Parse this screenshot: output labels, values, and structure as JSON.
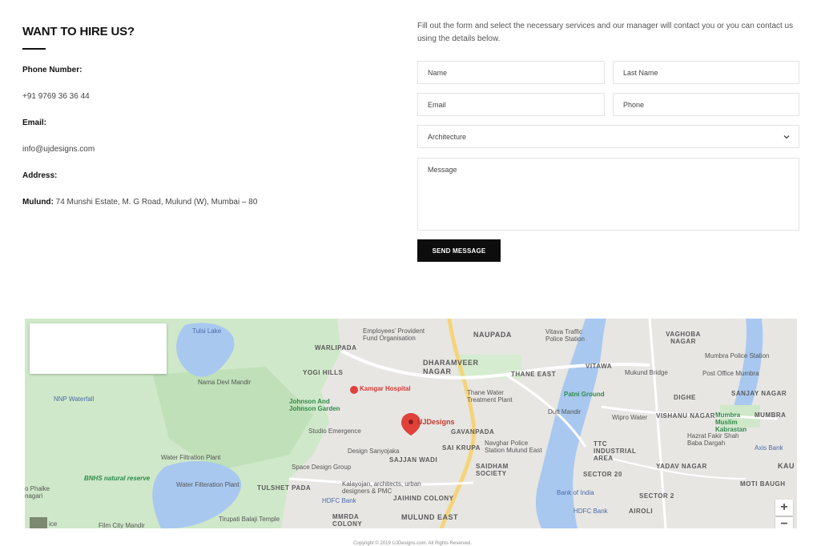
{
  "contact": {
    "title": "WANT TO HIRE US?",
    "phone_label": "Phone Number:",
    "phone_value": "+91 9769 36 36 44",
    "email_label": "Email:",
    "email_value": "info@ujdesigns.com",
    "address_label": "Address:",
    "address_city": "Mulund:",
    "address_value": "74 Munshi Estate, M. G Road, Mulund (W), Mumbai – 80"
  },
  "form": {
    "intro": "Fill out the form and select the necessary services and our manager will contact you or you can contact us using the details below.",
    "name_placeholder": "Name",
    "lastname_placeholder": "Last Name",
    "email_placeholder": "Email",
    "phone_placeholder": "Phone",
    "service_selected": "Architecture",
    "message_placeholder": "Message",
    "send_label": "SEND MESSAGE"
  },
  "map": {
    "marker_label": "UJDesigns",
    "zoom_in": "+",
    "zoom_out": "−",
    "labels": {
      "tulsi_lake": "Tulsi Lake",
      "warlipada": "WARLIPADA",
      "yogi_hills": "YOGI HILLS",
      "nama_devi": "Nama Devi Mandir",
      "nnp": "NNP Waterfall",
      "kamgar": "Kamgar Hospital",
      "johnson": "Johnson And Johnson Garden",
      "studio": "Studio Emergence",
      "design_sanyojaka": "Design Sanyojaka",
      "water_plant1": "Water Filtration Plant",
      "water_plant2": "Water Filteration Plant",
      "space_design": "Space Design Group",
      "bnhs": "BNHS natural reserve",
      "tulshet": "TULSHET PADA",
      "kalayojan": "Kalayojan, architects, urban designers & PMC",
      "hdfc1": "HDFC Bank",
      "tirupati": "Tirupati Balaji Temple",
      "film_city": "Film City Mandir",
      "mmrda": "MMRDA COLONY",
      "employees": "Employees' Provident Fund Organisation",
      "naupada": "NAUPADA",
      "dharamveer": "DHARAMVEER NAGAR",
      "gavanpada": "GAVANPADA",
      "sai_krupa": "SAI KRUPA",
      "sajjan": "SAJJAN WADI",
      "saidham": "SAIDHAM SOCIETY",
      "jaihind": "JAIHIND COLONY",
      "mulund_east": "MULUND EAST",
      "thane_east": "THANE EAST",
      "thane_water": "Thane Water Treatment Plant",
      "navghar": "Navghar Police Station Mulund East",
      "vitawa_traffic": "Vitava Traffic Police Station",
      "vitawa": "VITAWA",
      "patni": "Patni Ground",
      "dutt": "Dutt Mandir",
      "mukund": "Mukund Bridge",
      "wipro": "Wipro Water",
      "ttc": "TTC INDUSTRIAL AREA",
      "sector20": "SECTOR 20",
      "sector2": "SECTOR 2",
      "bank_india": "Bank of India",
      "hdfc2": "HDFC Bank",
      "airoli": "AIROLI",
      "yadav": "YADAV NAGAR",
      "vaghoba": "VAGHOBA NAGAR",
      "mumbra_ps": "Mumbra Police Station",
      "post_office": "Post Office Mumbra",
      "sanjay": "SANJAY NAGAR",
      "dighe": "DIGHE",
      "vishanu": "VISHANU NAGAR",
      "mumbra_kabrastan": "Mumbra Muslim Kabrastan",
      "mumbra": "MUMBRA",
      "hazrat": "Hazrat Fakir Shah Baba Dargah",
      "axis": "Axis Bank",
      "moti_baugh": "MOTI BAUGH",
      "kau": "KAU",
      "phalke": "o Phalke nagari",
      "ice": "ice"
    }
  },
  "footer": {
    "copyright": "Copyright © 2019 UJDesigns.com. All Rights Reserved."
  }
}
